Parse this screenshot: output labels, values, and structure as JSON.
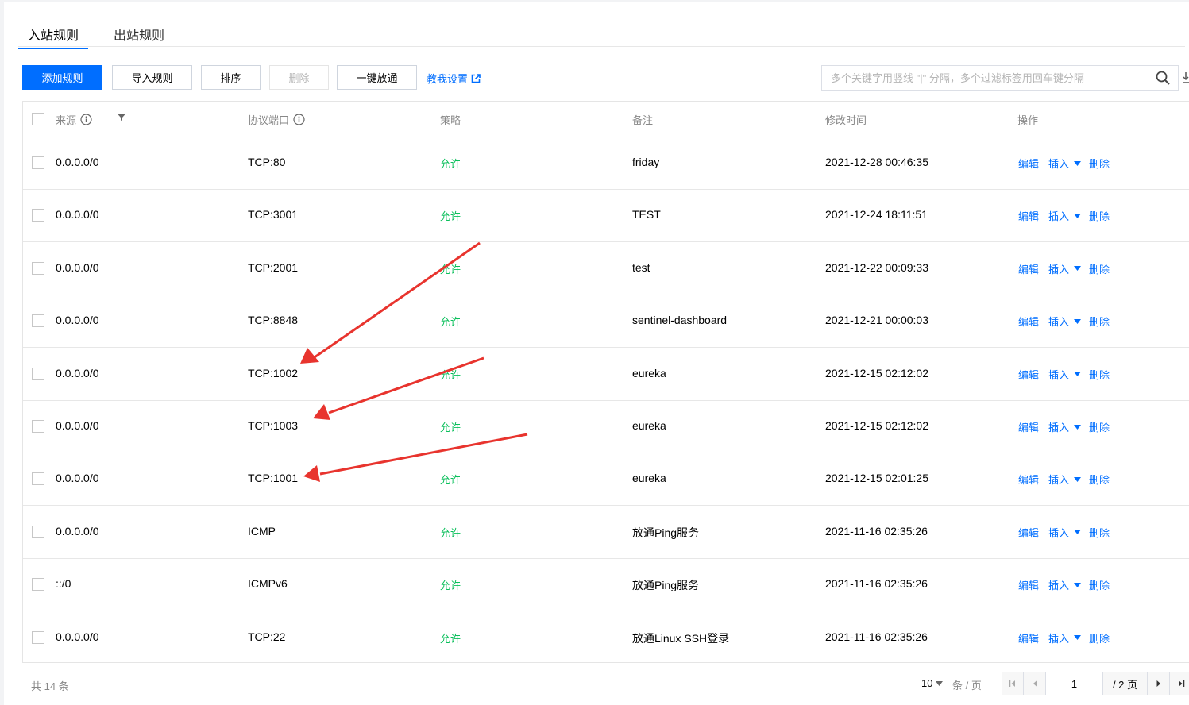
{
  "tabs": {
    "inbound": "入站规则",
    "outbound": "出站规则"
  },
  "toolbar": {
    "add": "添加规则",
    "import": "导入规则",
    "sort": "排序",
    "delete": "删除",
    "allow_all": "一键放通",
    "help": "教我设置",
    "search_placeholder": "多个关键字用竖线 \"|\" 分隔，多个过滤标签用回车键分隔"
  },
  "table": {
    "headers": {
      "source": "来源",
      "port": "协议端口",
      "policy": "策略",
      "remark": "备注",
      "modified": "修改时间",
      "actions": "操作"
    },
    "action_labels": {
      "edit": "编辑",
      "insert": "插入",
      "delete": "删除"
    },
    "rows": [
      {
        "source": "0.0.0.0/0",
        "port": "TCP:80",
        "policy": "允许",
        "remark": "friday",
        "modified": "2021-12-28 00:46:35"
      },
      {
        "source": "0.0.0.0/0",
        "port": "TCP:3001",
        "policy": "允许",
        "remark": "TEST",
        "modified": "2021-12-24 18:11:51"
      },
      {
        "source": "0.0.0.0/0",
        "port": "TCP:2001",
        "policy": "允许",
        "remark": "test",
        "modified": "2021-12-22 00:09:33"
      },
      {
        "source": "0.0.0.0/0",
        "port": "TCP:8848",
        "policy": "允许",
        "remark": "sentinel-dashboard",
        "modified": "2021-12-21 00:00:03"
      },
      {
        "source": "0.0.0.0/0",
        "port": "TCP:1002",
        "policy": "允许",
        "remark": "eureka",
        "modified": "2021-12-15 02:12:02"
      },
      {
        "source": "0.0.0.0/0",
        "port": "TCP:1003",
        "policy": "允许",
        "remark": "eureka",
        "modified": "2021-12-15 02:12:02"
      },
      {
        "source": "0.0.0.0/0",
        "port": "TCP:1001",
        "policy": "允许",
        "remark": "eureka",
        "modified": "2021-12-15 02:01:25"
      },
      {
        "source": "0.0.0.0/0",
        "port": "ICMP",
        "policy": "允许",
        "remark": "放通Ping服务",
        "modified": "2021-11-16 02:35:26"
      },
      {
        "source": "::/0",
        "port": "ICMPv6",
        "policy": "允许",
        "remark": "放通Ping服务",
        "modified": "2021-11-16 02:35:26"
      },
      {
        "source": "0.0.0.0/0",
        "port": "TCP:22",
        "policy": "允许",
        "remark": "放通Linux SSH登录",
        "modified": "2021-11-16 02:35:26"
      }
    ]
  },
  "footer": {
    "total": "共 14 条",
    "page_size": "10",
    "per_page": "条 / 页",
    "current_page": "1",
    "total_pages": "/ 2 页"
  },
  "colors": {
    "primary": "#006eff",
    "allow": "#0abf5b",
    "annotation": "#e8342e"
  }
}
